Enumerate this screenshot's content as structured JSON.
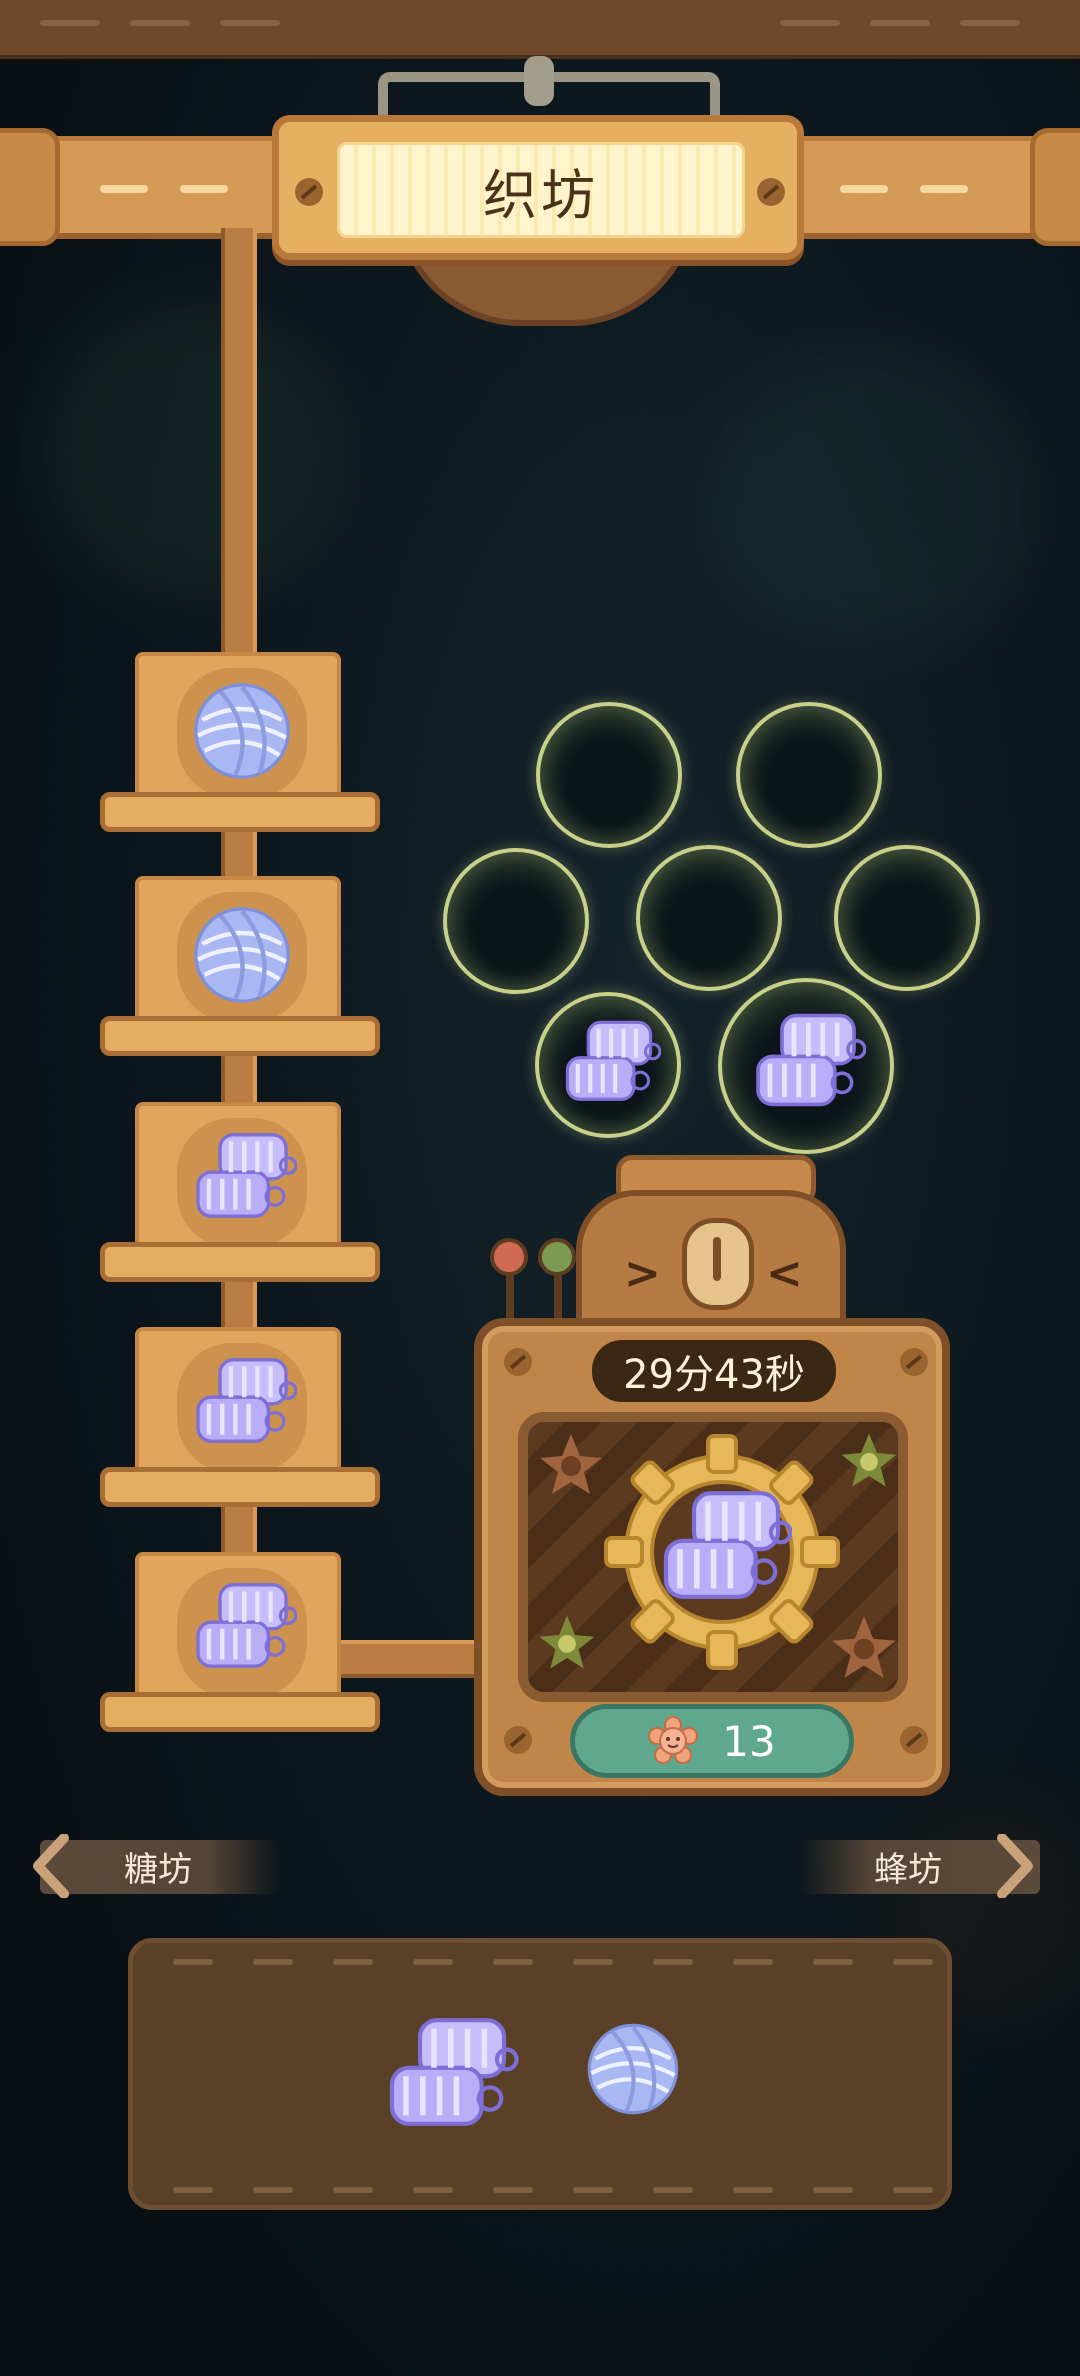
{
  "header": {
    "title": "织坊"
  },
  "queue": [
    {
      "item": "yarn-ball"
    },
    {
      "item": "yarn-ball"
    },
    {
      "item": "knitted-fabric"
    },
    {
      "item": "knitted-fabric"
    },
    {
      "item": "knitted-fabric"
    }
  ],
  "storage_slots": [
    {
      "item": "empty"
    },
    {
      "item": "empty"
    },
    {
      "item": "empty"
    },
    {
      "item": "empty"
    },
    {
      "item": "empty"
    },
    {
      "item": "knitted-fabric"
    },
    {
      "item": "knitted-fabric"
    }
  ],
  "machine": {
    "timer": "29分43秒",
    "producing": "knitted-fabric",
    "speedup_cost": "13",
    "speedup_currency_icon": "flower-coin-icon"
  },
  "navigation": {
    "prev_label": "糖坊",
    "next_label": "蜂坊"
  },
  "inventory": [
    {
      "item": "knitted-fabric"
    },
    {
      "item": "yarn-ball"
    }
  ],
  "colors": {
    "wood": "#c08548",
    "wood_dark": "#7f4f27",
    "yarn": "#a9b4f0",
    "fabric": "#b0a6f2",
    "bubble_rim": "#c8d18a",
    "reward_pill": "#5fa88e"
  }
}
